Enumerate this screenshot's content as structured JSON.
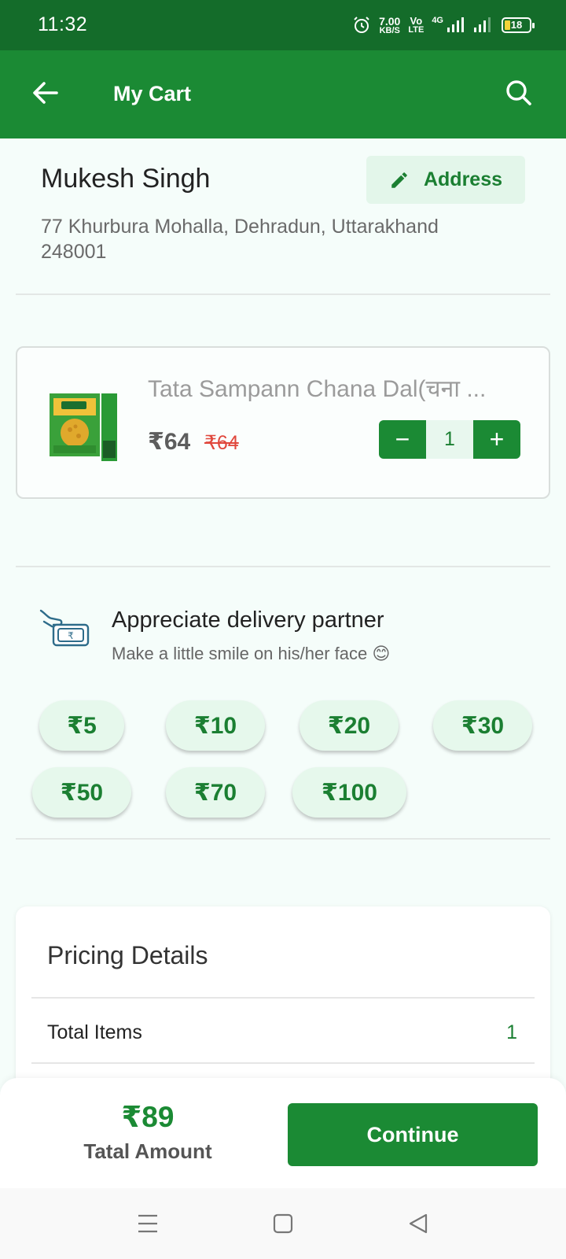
{
  "status_bar": {
    "time": "11:32",
    "net_speed_value": "7.00",
    "net_speed_unit": "KB/S",
    "volte_top": "Vo",
    "volte_bottom": "LTE",
    "network": "4G",
    "battery": "18"
  },
  "app_bar": {
    "title": "My Cart"
  },
  "delivery": {
    "name": "Mukesh Singh",
    "address_button_label": "Address",
    "address_line1": "77 Khurbura Mohalla, Dehradun, Uttarakhand",
    "address_line2": "248001"
  },
  "cart_item": {
    "name": "Tata Sampann Chana Dal(चना ...",
    "price": "₹64",
    "mrp": "₹64",
    "quantity": "1",
    "minus_label": "−",
    "plus_label": "+"
  },
  "tip": {
    "title": "Appreciate delivery partner",
    "subtitle": "Make a little smile on his/her face 😊",
    "options": [
      "₹5",
      "₹10",
      "₹20",
      "₹30",
      "₹50",
      "₹70",
      "₹100"
    ]
  },
  "pricing": {
    "title": "Pricing Details",
    "rows": [
      {
        "label": "Total Items",
        "value": "1"
      }
    ]
  },
  "checkout": {
    "total_amount": "₹89",
    "total_label": "Tatal Amount",
    "continue_label": "Continue"
  },
  "colors": {
    "status_bar": "#146c2a",
    "primary": "#1b8a34",
    "light_green": "#e3f6ea",
    "strike_price": "#e0473c"
  },
  "icons": {
    "back": "arrow-left-icon",
    "search": "search-icon",
    "edit": "pencil-icon",
    "tip": "hand-money-icon"
  }
}
